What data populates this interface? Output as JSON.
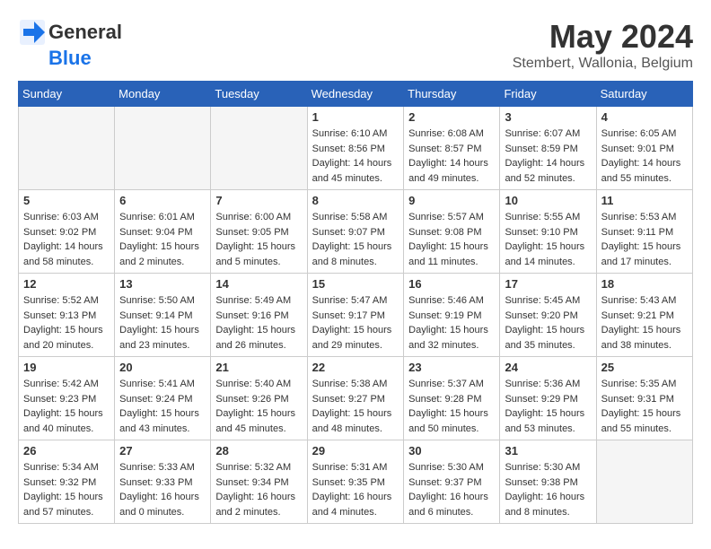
{
  "header": {
    "logo_general": "General",
    "logo_blue": "Blue",
    "month_title": "May 2024",
    "location": "Stembert, Wallonia, Belgium"
  },
  "days_of_week": [
    "Sunday",
    "Monday",
    "Tuesday",
    "Wednesday",
    "Thursday",
    "Friday",
    "Saturday"
  ],
  "weeks": [
    [
      {
        "day": "",
        "info": ""
      },
      {
        "day": "",
        "info": ""
      },
      {
        "day": "",
        "info": ""
      },
      {
        "day": "1",
        "info": "Sunrise: 6:10 AM\nSunset: 8:56 PM\nDaylight: 14 hours and 45 minutes."
      },
      {
        "day": "2",
        "info": "Sunrise: 6:08 AM\nSunset: 8:57 PM\nDaylight: 14 hours and 49 minutes."
      },
      {
        "day": "3",
        "info": "Sunrise: 6:07 AM\nSunset: 8:59 PM\nDaylight: 14 hours and 52 minutes."
      },
      {
        "day": "4",
        "info": "Sunrise: 6:05 AM\nSunset: 9:01 PM\nDaylight: 14 hours and 55 minutes."
      }
    ],
    [
      {
        "day": "5",
        "info": "Sunrise: 6:03 AM\nSunset: 9:02 PM\nDaylight: 14 hours and 58 minutes."
      },
      {
        "day": "6",
        "info": "Sunrise: 6:01 AM\nSunset: 9:04 PM\nDaylight: 15 hours and 2 minutes."
      },
      {
        "day": "7",
        "info": "Sunrise: 6:00 AM\nSunset: 9:05 PM\nDaylight: 15 hours and 5 minutes."
      },
      {
        "day": "8",
        "info": "Sunrise: 5:58 AM\nSunset: 9:07 PM\nDaylight: 15 hours and 8 minutes."
      },
      {
        "day": "9",
        "info": "Sunrise: 5:57 AM\nSunset: 9:08 PM\nDaylight: 15 hours and 11 minutes."
      },
      {
        "day": "10",
        "info": "Sunrise: 5:55 AM\nSunset: 9:10 PM\nDaylight: 15 hours and 14 minutes."
      },
      {
        "day": "11",
        "info": "Sunrise: 5:53 AM\nSunset: 9:11 PM\nDaylight: 15 hours and 17 minutes."
      }
    ],
    [
      {
        "day": "12",
        "info": "Sunrise: 5:52 AM\nSunset: 9:13 PM\nDaylight: 15 hours and 20 minutes."
      },
      {
        "day": "13",
        "info": "Sunrise: 5:50 AM\nSunset: 9:14 PM\nDaylight: 15 hours and 23 minutes."
      },
      {
        "day": "14",
        "info": "Sunrise: 5:49 AM\nSunset: 9:16 PM\nDaylight: 15 hours and 26 minutes."
      },
      {
        "day": "15",
        "info": "Sunrise: 5:47 AM\nSunset: 9:17 PM\nDaylight: 15 hours and 29 minutes."
      },
      {
        "day": "16",
        "info": "Sunrise: 5:46 AM\nSunset: 9:19 PM\nDaylight: 15 hours and 32 minutes."
      },
      {
        "day": "17",
        "info": "Sunrise: 5:45 AM\nSunset: 9:20 PM\nDaylight: 15 hours and 35 minutes."
      },
      {
        "day": "18",
        "info": "Sunrise: 5:43 AM\nSunset: 9:21 PM\nDaylight: 15 hours and 38 minutes."
      }
    ],
    [
      {
        "day": "19",
        "info": "Sunrise: 5:42 AM\nSunset: 9:23 PM\nDaylight: 15 hours and 40 minutes."
      },
      {
        "day": "20",
        "info": "Sunrise: 5:41 AM\nSunset: 9:24 PM\nDaylight: 15 hours and 43 minutes."
      },
      {
        "day": "21",
        "info": "Sunrise: 5:40 AM\nSunset: 9:26 PM\nDaylight: 15 hours and 45 minutes."
      },
      {
        "day": "22",
        "info": "Sunrise: 5:38 AM\nSunset: 9:27 PM\nDaylight: 15 hours and 48 minutes."
      },
      {
        "day": "23",
        "info": "Sunrise: 5:37 AM\nSunset: 9:28 PM\nDaylight: 15 hours and 50 minutes."
      },
      {
        "day": "24",
        "info": "Sunrise: 5:36 AM\nSunset: 9:29 PM\nDaylight: 15 hours and 53 minutes."
      },
      {
        "day": "25",
        "info": "Sunrise: 5:35 AM\nSunset: 9:31 PM\nDaylight: 15 hours and 55 minutes."
      }
    ],
    [
      {
        "day": "26",
        "info": "Sunrise: 5:34 AM\nSunset: 9:32 PM\nDaylight: 15 hours and 57 minutes."
      },
      {
        "day": "27",
        "info": "Sunrise: 5:33 AM\nSunset: 9:33 PM\nDaylight: 16 hours and 0 minutes."
      },
      {
        "day": "28",
        "info": "Sunrise: 5:32 AM\nSunset: 9:34 PM\nDaylight: 16 hours and 2 minutes."
      },
      {
        "day": "29",
        "info": "Sunrise: 5:31 AM\nSunset: 9:35 PM\nDaylight: 16 hours and 4 minutes."
      },
      {
        "day": "30",
        "info": "Sunrise: 5:30 AM\nSunset: 9:37 PM\nDaylight: 16 hours and 6 minutes."
      },
      {
        "day": "31",
        "info": "Sunrise: 5:30 AM\nSunset: 9:38 PM\nDaylight: 16 hours and 8 minutes."
      },
      {
        "day": "",
        "info": ""
      }
    ]
  ]
}
